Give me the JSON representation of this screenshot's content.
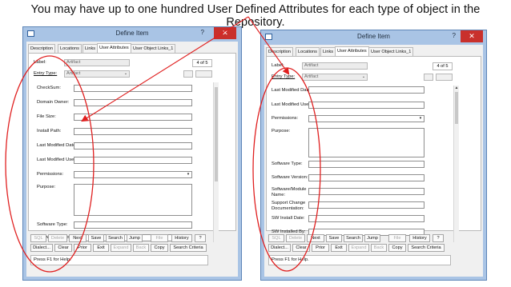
{
  "caption": "You may have up to one hundred User Defined Attributes for each type of object in the Repository.",
  "dialog": {
    "title": "Define Item",
    "help": "?",
    "close": "✕",
    "tabs": [
      "Description",
      "Locations",
      "Links",
      "User Attributes",
      "User Object Links_1"
    ],
    "label_caption": "Label:",
    "label_value": "Artifact",
    "entry_type_caption": "Entry Type:",
    "entry_type_value": "Artifact",
    "page_count": "4 of 5",
    "buttons_row1": [
      "SQL",
      "Delete",
      "Next",
      "Save",
      "Search",
      "Jump",
      "File",
      "History",
      "?"
    ],
    "buttons_row2": [
      "Dialect...",
      "Clear",
      "Prior",
      "Exit",
      "Expand",
      "Back",
      "Copy",
      "Search Criteria"
    ],
    "status": "Press F1 for Help."
  },
  "left_fields": [
    "CheckSum:",
    "Domain Owner:",
    "File Size:",
    "Install Path:",
    "Last Modified Date:",
    "Last Modified User:",
    "Permissions:",
    "Purpose:",
    "Software Type:",
    "Software Version:"
  ],
  "right_fields": [
    "Last Modified Date:",
    "Last Modified User:",
    "Permissions:",
    "Purpose:",
    "Software Type:",
    "Software Version:",
    "Software/Module Name:",
    "Support Change Documentation:",
    "SW Install Date:",
    "SW Installed By:"
  ]
}
